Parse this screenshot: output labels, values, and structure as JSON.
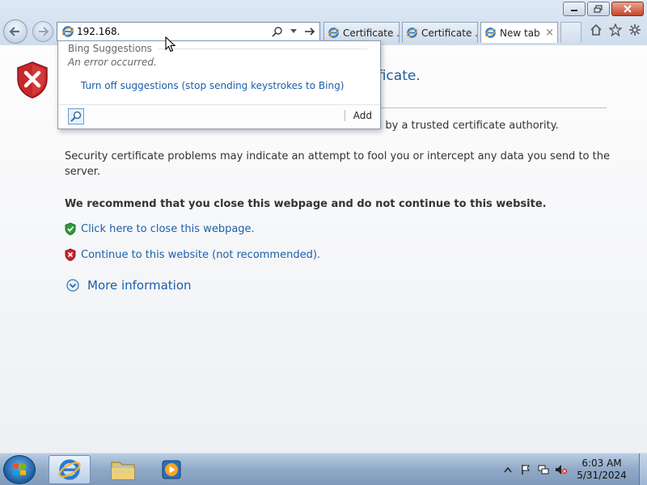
{
  "browser": {
    "address_value": "192.168.",
    "tabs": [
      {
        "label": "Certificate ..."
      },
      {
        "label": "Certificate ..."
      },
      {
        "label": "New tab"
      }
    ],
    "tab_close": "×"
  },
  "suggestions": {
    "header": "Bing Suggestions",
    "error": "An error occurred.",
    "turn_off": "Turn off suggestions (stop sending keystrokes to Bing)",
    "add_label": "Add"
  },
  "page": {
    "title_fragment": "ificate.",
    "p1_fragment": "ed by a trusted certificate authority.",
    "p2": "Security certificate problems may indicate an attempt to fool you or intercept any data you send to the server.",
    "p3": "We recommend that you close this webpage and do not continue to this website.",
    "close_link": "Click here to close this webpage.",
    "continue_link": "Continue to this website (not recommended).",
    "more_info": "More information"
  },
  "taskbar": {
    "time": "6:03 AM",
    "date": "5/31/2024"
  },
  "colors": {
    "link": "#1a5fa8",
    "title": "#1f5d9a",
    "shield_red": "#c8262a",
    "shield_green": "#2e9b3a"
  }
}
